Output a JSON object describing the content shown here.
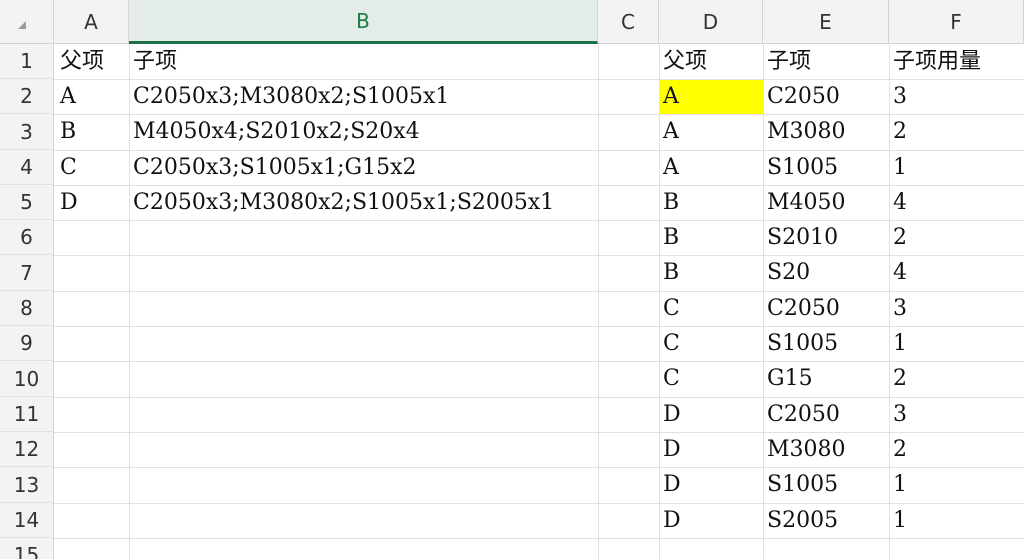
{
  "columns": [
    "A",
    "B",
    "C",
    "D",
    "E",
    "F"
  ],
  "selected_column": "B",
  "rows": [
    "1",
    "2",
    "3",
    "4",
    "5",
    "6",
    "7",
    "8",
    "9",
    "10",
    "11",
    "12",
    "13",
    "14",
    "15"
  ],
  "left_table": {
    "headers": [
      "父项",
      "子项"
    ],
    "rows": [
      [
        "A",
        "C2050x3;M3080x2;S1005x1"
      ],
      [
        "B",
        "M4050x4;S2010x2;S20x4"
      ],
      [
        "C",
        "C2050x3;S1005x1;G15x2"
      ],
      [
        "D",
        "C2050x3;M3080x2;S1005x1;S2005x1"
      ]
    ]
  },
  "right_table": {
    "headers": [
      "父项",
      "子项",
      "子项用量"
    ],
    "rows": [
      [
        "A",
        "C2050",
        "3"
      ],
      [
        "A",
        "M3080",
        "2"
      ],
      [
        "A",
        "S1005",
        "1"
      ],
      [
        "B",
        "M4050",
        "4"
      ],
      [
        "B",
        "S2010",
        "2"
      ],
      [
        "B",
        "S20",
        "4"
      ],
      [
        "C",
        "C2050",
        "3"
      ],
      [
        "C",
        "S1005",
        "1"
      ],
      [
        "C",
        "G15",
        "2"
      ],
      [
        "D",
        "C2050",
        "3"
      ],
      [
        "D",
        "M3080",
        "2"
      ],
      [
        "D",
        "S1005",
        "1"
      ],
      [
        "D",
        "S2005",
        "1"
      ]
    ]
  },
  "highlight_cell": "D2",
  "highlight_color": "#ffff00",
  "accent_color": "#1e7145"
}
